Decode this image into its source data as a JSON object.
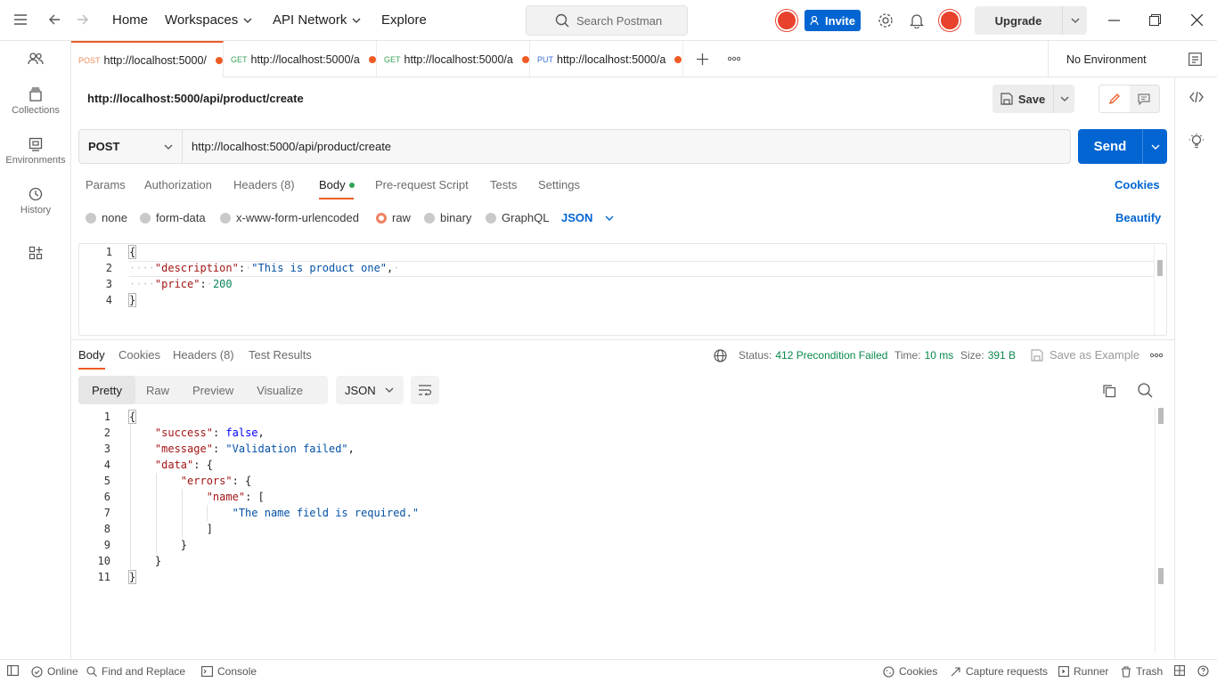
{
  "topbar": {
    "nav": [
      "Home",
      "Workspaces",
      "API Network",
      "Explore"
    ],
    "search_placeholder": "Search Postman",
    "invite_label": "Invite",
    "upgrade_label": "Upgrade"
  },
  "sidebar": {
    "items": [
      {
        "label": "",
        "icon": "team-icon"
      },
      {
        "label": "Collections",
        "icon": "collections-icon"
      },
      {
        "label": "Environments",
        "icon": "environments-icon"
      },
      {
        "label": "History",
        "icon": "history-icon"
      },
      {
        "label": "",
        "icon": "apps-icon"
      }
    ]
  },
  "tabs": [
    {
      "method": "POST",
      "url": "http://localhost:5000/",
      "active": true,
      "method_color": "#ef8a5c"
    },
    {
      "method": "GET",
      "url": "http://localhost:5000/a",
      "method_color": "#3aa35a"
    },
    {
      "method": "GET",
      "url": "http://localhost:5000/a",
      "method_color": "#3aa35a"
    },
    {
      "method": "PUT",
      "url": "http://localhost:5000/a",
      "method_color": "#3a6fd8"
    }
  ],
  "environment": "No Environment",
  "request": {
    "title": "http://localhost:5000/api/product/create",
    "save_label": "Save",
    "method": "POST",
    "url": "http://localhost:5000/api/product/create",
    "send_label": "Send",
    "subtabs": [
      "Params",
      "Authorization",
      "Headers (8)",
      "Body",
      "Pre-request Script",
      "Tests",
      "Settings"
    ],
    "cookies_label": "Cookies",
    "body_types": [
      "none",
      "form-data",
      "x-www-form-urlencoded",
      "raw",
      "binary",
      "GraphQL"
    ],
    "body_format": "JSON",
    "beautify_label": "Beautify"
  },
  "request_body": {
    "line_numbers": [
      "1",
      "2",
      "3",
      "4"
    ],
    "open": "{",
    "desc_key": "\"description\"",
    "desc_val": "\"This is product one\"",
    "price_key": "\"price\"",
    "price_val": "200",
    "close": "}"
  },
  "response": {
    "tabs": [
      "Body",
      "Cookies",
      "Headers (8)",
      "Test Results"
    ],
    "status_label": "Status:",
    "status_value": "412 Precondition Failed",
    "time_label": "Time:",
    "time_value": "10 ms",
    "size_label": "Size:",
    "size_value": "391 B",
    "save_example_label": "Save as Example",
    "views": [
      "Pretty",
      "Raw",
      "Preview",
      "Visualize"
    ],
    "format": "JSON"
  },
  "response_body": {
    "line_numbers": [
      "1",
      "2",
      "3",
      "4",
      "5",
      "6",
      "7",
      "8",
      "9",
      "10",
      "11"
    ],
    "success_key": "\"success\"",
    "success_val": "false",
    "message_key": "\"message\"",
    "message_val": "\"Validation failed\"",
    "data_key": "\"data\"",
    "errors_key": "\"errors\"",
    "name_key": "\"name\"",
    "error_text": "\"The name field is required.\""
  },
  "statusbar": {
    "online": "Online",
    "find_replace": "Find and Replace",
    "console": "Console",
    "cookies": "Cookies",
    "capture": "Capture requests",
    "runner": "Runner",
    "trash": "Trash"
  }
}
